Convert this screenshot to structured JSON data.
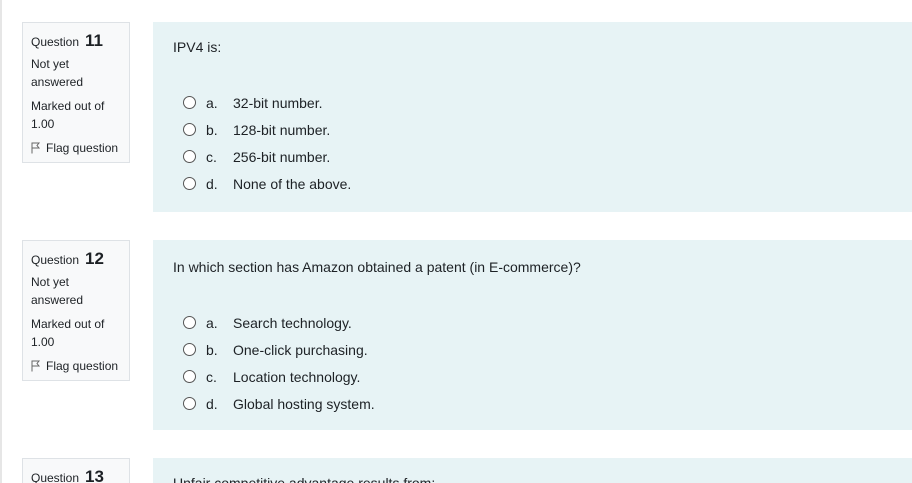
{
  "questions": [
    {
      "label": "Question",
      "number": "11",
      "state": "Not yet answered",
      "grade": "Marked out of 1.00",
      "flag": "Flag question",
      "text": "IPV4 is:",
      "answers": [
        {
          "letter": "a.",
          "text": "32-bit number."
        },
        {
          "letter": "b.",
          "text": "128-bit number."
        },
        {
          "letter": "c.",
          "text": "256-bit number."
        },
        {
          "letter": "d.",
          "text": "None of the above."
        }
      ]
    },
    {
      "label": "Question",
      "number": "12",
      "state": "Not yet answered",
      "grade": "Marked out of 1.00",
      "flag": "Flag question",
      "text": "In which section has Amazon obtained a patent (in E-commerce)?",
      "answers": [
        {
          "letter": "a.",
          "text": "Search technology."
        },
        {
          "letter": "b.",
          "text": "One-click purchasing."
        },
        {
          "letter": "c.",
          "text": "Location technology."
        },
        {
          "letter": "d.",
          "text": "Global hosting system."
        }
      ]
    },
    {
      "label": "Question",
      "number": "13",
      "text": "Unfair competitive advantage results from:"
    }
  ]
}
